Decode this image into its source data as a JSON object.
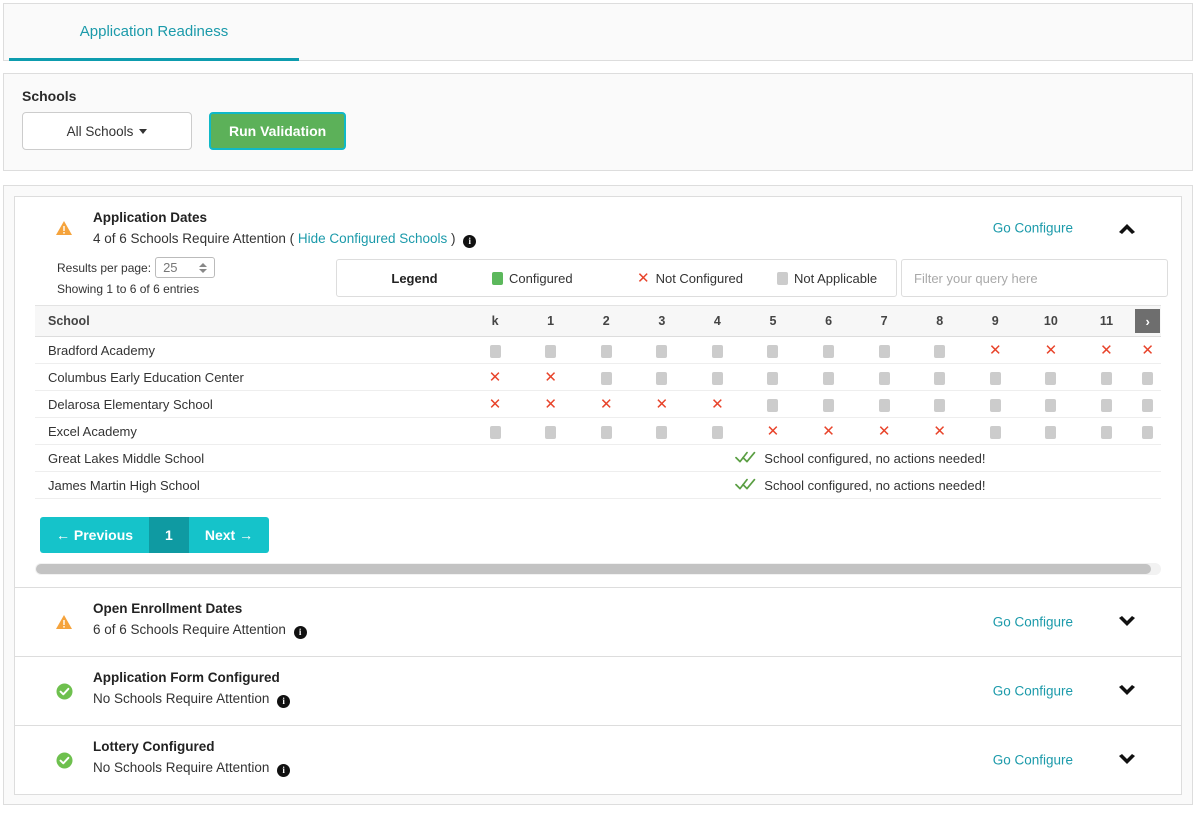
{
  "tabs": [
    {
      "label": "Application Readiness",
      "active": true
    }
  ],
  "schools_panel": {
    "label": "Schools",
    "dropdown_value": "All Schools",
    "run_validation_label": "Run Validation"
  },
  "colors": {
    "teal": "#1b9aaa",
    "teal_bright": "#15c3ca",
    "teal_dark": "#0f9aa2",
    "green": "#5cb159",
    "green_swatch": "#5cb85c",
    "red_x": "#e8442b",
    "grey_na": "#cccccc",
    "warning_orange": "#f5a33c",
    "scroll_btn_grey": "#6e6e6e"
  },
  "sections": [
    {
      "id": "application-dates",
      "title": "Application Dates",
      "subtitle": "4 of 6 Schools Require Attention",
      "toggle_link": "Hide Configured Schools",
      "toggle_prefix": "(",
      "toggle_suffix": ")",
      "info_glyph": "i",
      "status_icon": "warning-triangle-icon",
      "go_configure": "Go Configure",
      "chevron": "chevron-up-icon",
      "expanded": true
    },
    {
      "id": "open-enrollment-dates",
      "title": "Open Enrollment Dates",
      "subtitle": "6 of 6 Schools Require Attention",
      "info_glyph": "i",
      "status_icon": "warning-triangle-icon",
      "go_configure": "Go Configure",
      "chevron": "chevron-down-icon",
      "expanded": false
    },
    {
      "id": "application-form-configured",
      "title": "Application Form Configured",
      "subtitle": "No Schools Require Attention",
      "info_glyph": "i",
      "status_icon": "check-circle-icon",
      "go_configure": "Go Configure",
      "chevron": "chevron-down-icon",
      "expanded": false
    },
    {
      "id": "lottery-configured",
      "title": "Lottery Configured",
      "subtitle": "No Schools Require Attention",
      "info_glyph": "i",
      "status_icon": "check-circle-icon",
      "go_configure": "Go Configure",
      "chevron": "chevron-down-icon",
      "expanded": false
    }
  ],
  "toolbar": {
    "results_per_page_label": "Results per page:",
    "results_per_page_value": "25",
    "showing_text": "Showing 1 to 6 of 6 entries",
    "legend_title": "Legend",
    "legend_items": [
      {
        "marker": "green-square",
        "label": "Configured"
      },
      {
        "marker": "red-x",
        "label": "Not Configured"
      },
      {
        "marker": "grey-square",
        "label": "Not Applicable"
      }
    ],
    "filter_placeholder": "Filter your query here",
    "filter_value": ""
  },
  "table": {
    "school_column_header": "School",
    "grade_columns": [
      "k",
      "1",
      "2",
      "3",
      "4",
      "5",
      "6",
      "7",
      "8",
      "9",
      "10",
      "11"
    ],
    "scroll_next_glyph": "›",
    "configured_message": "School configured, no actions needed!",
    "rows": [
      {
        "school": "Bradford Academy",
        "type": "grades",
        "cells": [
          "na",
          "na",
          "na",
          "na",
          "na",
          "na",
          "na",
          "na",
          "na",
          "x",
          "x",
          "x",
          "x"
        ]
      },
      {
        "school": "Columbus Early Education Center",
        "type": "grades",
        "cells": [
          "x",
          "x",
          "na",
          "na",
          "na",
          "na",
          "na",
          "na",
          "na",
          "na",
          "na",
          "na",
          "na"
        ]
      },
      {
        "school": "Delarosa Elementary School",
        "type": "grades",
        "cells": [
          "x",
          "x",
          "x",
          "x",
          "x",
          "na",
          "na",
          "na",
          "na",
          "na",
          "na",
          "na",
          "na"
        ]
      },
      {
        "school": "Excel Academy",
        "type": "grades",
        "cells": [
          "na",
          "na",
          "na",
          "na",
          "na",
          "x",
          "x",
          "x",
          "x",
          "na",
          "na",
          "na",
          "na"
        ]
      },
      {
        "school": "Great Lakes Middle School",
        "type": "configured"
      },
      {
        "school": "James Martin High School",
        "type": "configured"
      }
    ]
  },
  "pagination": {
    "previous_label": "← Previous",
    "pages": [
      "1"
    ],
    "current_page": "1",
    "next_label": "Next →"
  }
}
